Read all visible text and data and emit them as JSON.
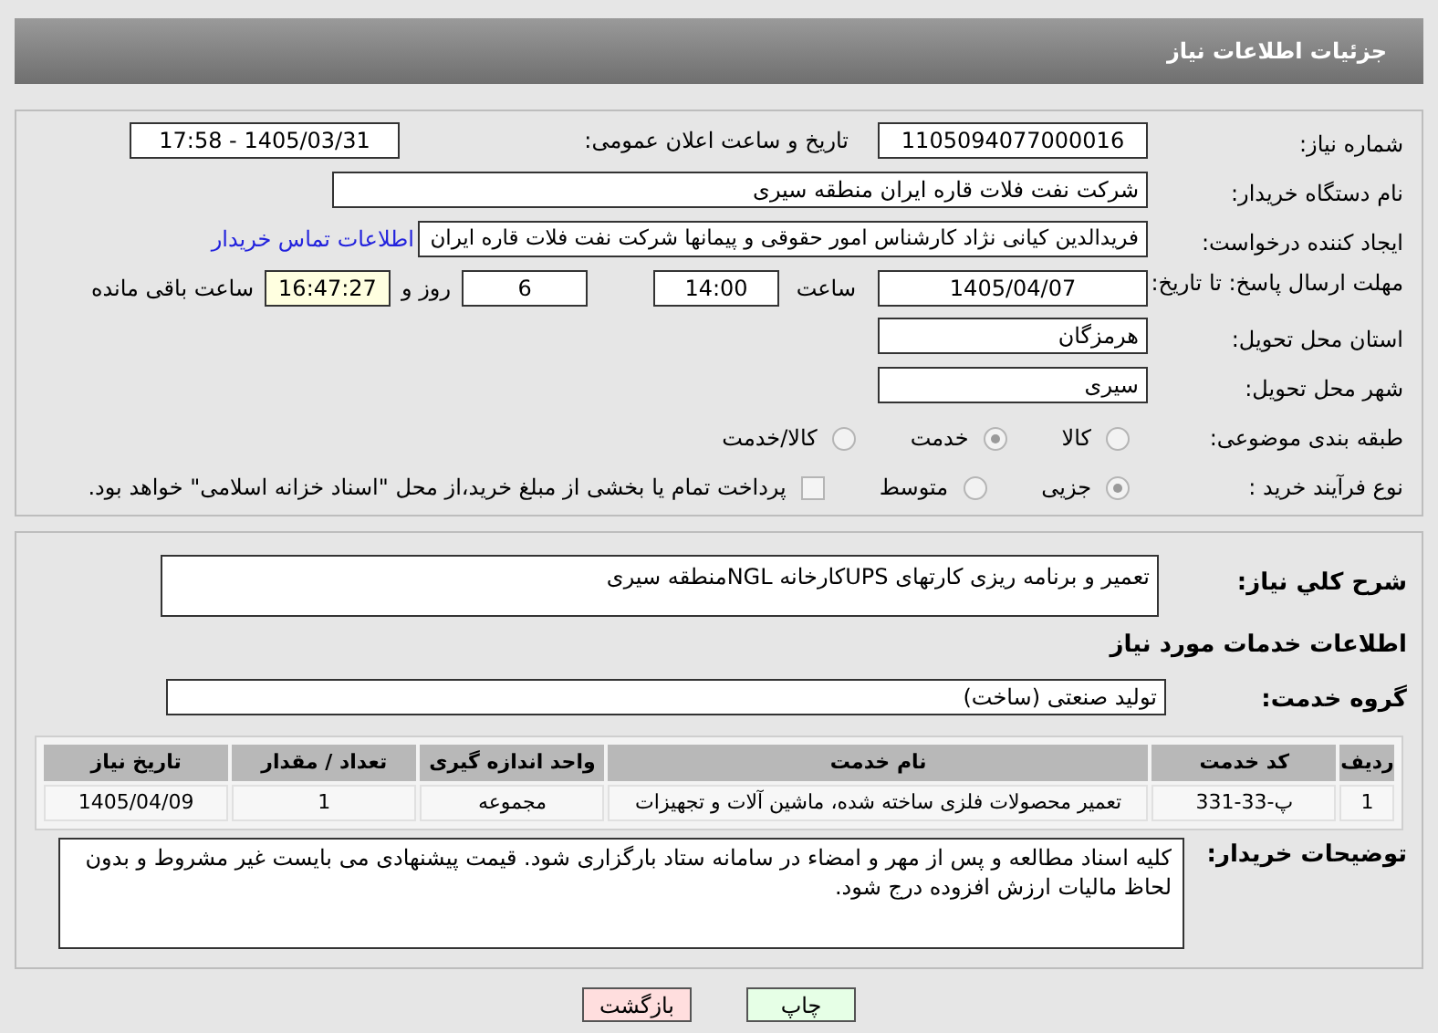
{
  "header": {
    "title": "جزئیات اطلاعات نیاز"
  },
  "need_number": {
    "label": "شماره نیاز:",
    "value": "1105094077000016"
  },
  "announce": {
    "label": "تاریخ و ساعت اعلان عمومی:",
    "value": "1405/03/31 - 17:58"
  },
  "buyer_org": {
    "label": "نام دستگاه خریدار:",
    "value": "شرکت نفت فلات قاره ایران منطقه سیری"
  },
  "requester": {
    "label": "ایجاد کننده درخواست:",
    "value": "فریدالدین کیانی نژاد کارشناس امور حقوقی و پیمانها شرکت نفت فلات قاره ایران",
    "link": "اطلاعات تماس خریدار"
  },
  "deadline": {
    "label": "مهلت ارسال پاسخ: تا تاریخ:",
    "date": "1405/04/07",
    "time_label": "ساعت",
    "time": "14:00",
    "days": "6",
    "days_label": "روز و",
    "remaining": "16:47:27",
    "remaining_label": "ساعت باقی مانده"
  },
  "province": {
    "label": "استان محل تحویل:",
    "value": "هرمزگان"
  },
  "city": {
    "label": "شهر محل تحویل:",
    "value": "سیری"
  },
  "category": {
    "label": "طبقه بندی موضوعی:",
    "options": [
      {
        "label": "کالا",
        "selected": false
      },
      {
        "label": "خدمت",
        "selected": true
      },
      {
        "label": "کالا/خدمت",
        "selected": false
      }
    ]
  },
  "process": {
    "label": "نوع فرآیند خرید :",
    "options": [
      {
        "label": "جزیی",
        "selected": true
      },
      {
        "label": "متوسط",
        "selected": false
      }
    ],
    "treasury": {
      "label": "پرداخت تمام یا بخشی از مبلغ خرید،از محل \"اسناد خزانه اسلامی\" خواهد بود.",
      "checked": false
    }
  },
  "description": {
    "label": "شرح كلي نياز:",
    "value": "تعمیر و برنامه ریزی کارتهای UPSکارخانه NGLمنطقه سیری"
  },
  "services_heading": "اطلاعات خدمات مورد نیاز",
  "service_group": {
    "label": "گروه خدمت:",
    "value": "تولید صنعتی (ساخت)"
  },
  "table": {
    "columns": [
      "ردیف",
      "کد خدمت",
      "نام خدمت",
      "واحد اندازه گیری",
      "تعداد / مقدار",
      "تاریخ نیاز"
    ],
    "rows": [
      [
        "1",
        "پ-33-331",
        "تعمیر محصولات فلزی ساخته شده، ماشین آلات و تجهیزات",
        "مجموعه",
        "1",
        "1405/04/09"
      ]
    ]
  },
  "buyer_notes": {
    "label": "توضیحات خریدار:",
    "value": "کلیه اسناد مطالعه و پس از مهر و امضاء در سامانه ستاد بارگزاری شود. قیمت پیشنهادی می بایست غیر مشروط و بدون لحاظ مالیات ارزش افزوده درج شود."
  },
  "buttons": [
    {
      "kind": "print",
      "label": "چاپ"
    },
    {
      "kind": "back",
      "label": "بازگشت"
    }
  ]
}
